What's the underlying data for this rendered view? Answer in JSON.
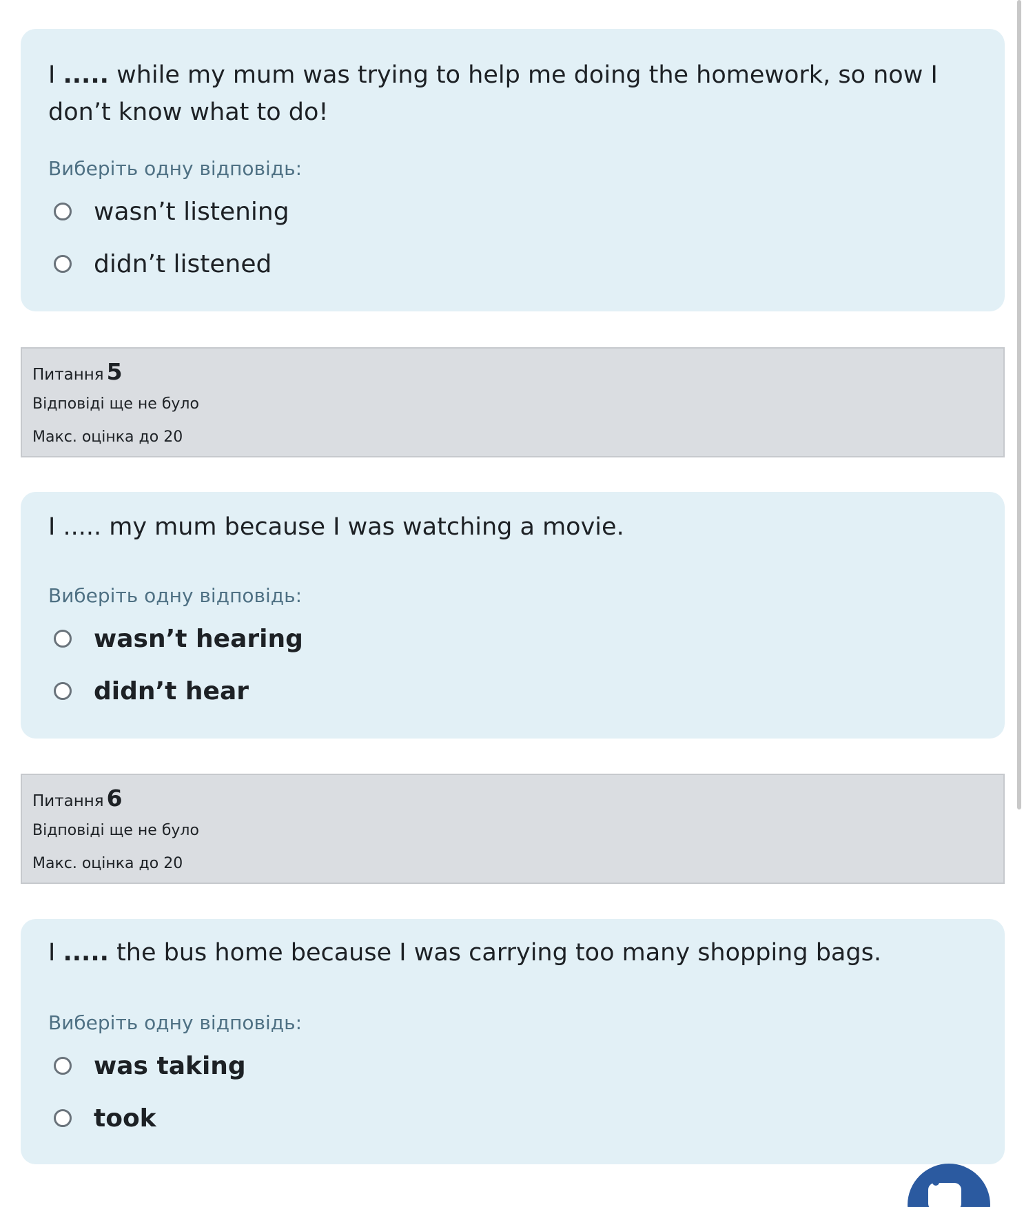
{
  "questions": [
    {
      "text_pre": "I ",
      "gap": ".....",
      "gap_bold": true,
      "text_post": " while my mum was trying to help me doing the homework, so now I don’t know what to do!",
      "prompt": "Виберіть одну відповідь:",
      "answers": [
        "wasn’t listening",
        "didn’t listened"
      ],
      "answers_bold": false
    },
    {
      "number": "5",
      "label": "Питання",
      "status": "Відповіді ще не було",
      "max_grade": "Макс. оцінка до 20",
      "text_pre": "I ",
      "gap": ".....",
      "gap_bold": false,
      "text_post": " my mum because I was watching a movie.",
      "prompt": "Виберіть одну відповідь:",
      "answers": [
        "wasn’t hearing",
        "didn’t hear"
      ],
      "answers_bold": true
    },
    {
      "number": "6",
      "label": "Питання",
      "status": "Відповіді ще не було",
      "max_grade": "Макс. оцінка до 20",
      "text_pre": "I ",
      "gap": ".....",
      "gap_bold": true,
      "text_post": " the bus home because I was carrying too many shopping bags.",
      "prompt": "Виберіть одну відповідь:",
      "answers": [
        "was taking",
        "took"
      ],
      "answers_bold": true
    }
  ],
  "fab": {
    "icon": "chat-icon",
    "color": "#2b5aa0"
  },
  "colors": {
    "card_bg": "#e2f0f6",
    "info_bg": "#dadde1",
    "prompt_text": "#4f7184"
  }
}
